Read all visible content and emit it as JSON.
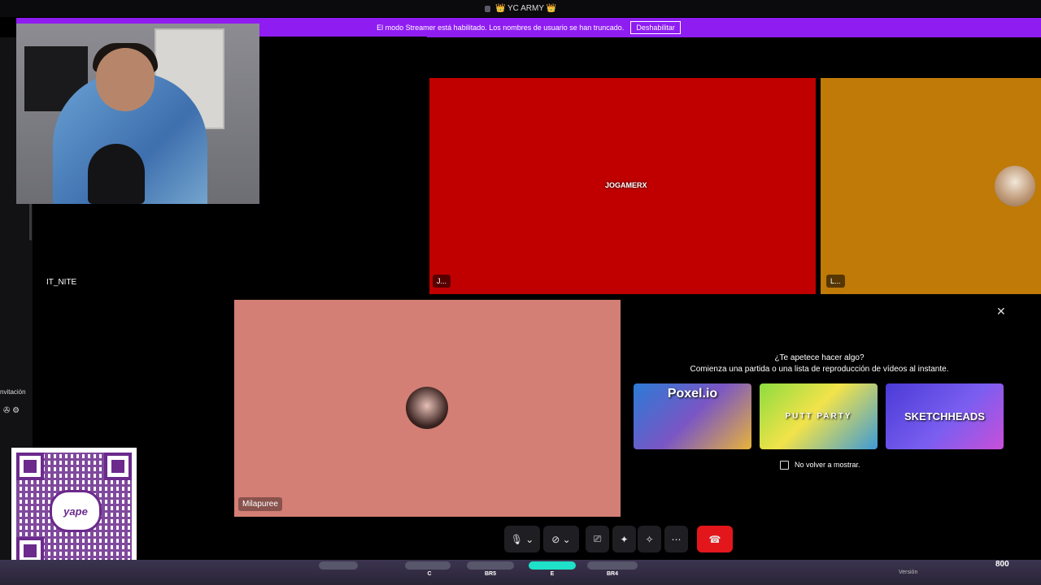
{
  "window": {
    "title": "👑 YC ARMY 👑"
  },
  "streamer_banner": {
    "text": "El modo Streamer está habilitado. Los nombres de usuario se han truncado.",
    "button_label": "Deshabilitar"
  },
  "tiles": {
    "tile1": {
      "name": "IT_NITE"
    },
    "tile2": {
      "name": "J...",
      "logo": "JOGAMERX"
    },
    "tile3": {
      "name": "L..."
    },
    "tile4": {
      "name": "Milapuree"
    }
  },
  "activities": {
    "close_label": "✕",
    "heading": "¿Te apetece hacer algo?",
    "subheading": "Comienza una partida o una lista de reproducción de vídeos al instante.",
    "games": [
      "Poxel.io",
      "PUTT PARTY",
      "SKETCHHEADS"
    ],
    "dont_show_label": "No volver a mostrar."
  },
  "sidebar": {
    "invite_label": "nvitación",
    "icons_label": "✇ ⚙"
  },
  "qr": {
    "label": "yape"
  },
  "controls": {
    "mic": "🎙 ⌄",
    "camera": "⊘ ⌄",
    "share": "⎚",
    "activities": "✦",
    "effects": "✧",
    "more": "⋯",
    "hangup": "☎"
  },
  "hud": {
    "labels": [
      "C",
      "BR5",
      "E",
      "BR4"
    ],
    "score": "800",
    "version": "Versión"
  }
}
